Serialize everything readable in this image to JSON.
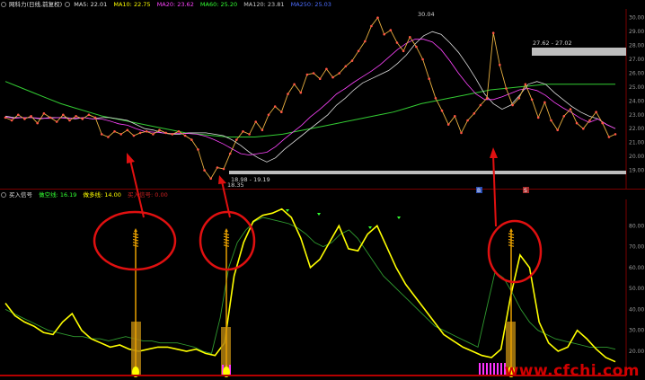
{
  "header": {
    "stock_name": "网科力(日线,前复权)",
    "ma5": "MA5: 22.01",
    "ma10": "MA10: 22.75",
    "ma20": "MA20: 23.62",
    "ma60": "MA60: 25.20",
    "ma120": "MA120: 23.81",
    "ma250": "MA250: 25.03",
    "colors": {
      "ma5": "#e0e0e0",
      "ma10": "#ffff00",
      "ma20": "#ff44ff",
      "ma60": "#33ff33",
      "ma120": "#c8c8c8",
      "ma250": "#4d6dff"
    }
  },
  "indicator_header": {
    "name": "买入信号",
    "line1": "做空线: 16.19",
    "line2": "做多线: 14.00",
    "line3": "买入信号: 0.00"
  },
  "price_axis": {
    "ticks": [
      "30.00",
      "29.00",
      "28.00",
      "27.00",
      "26.00",
      "25.00",
      "24.00",
      "23.00",
      "22.00",
      "21.00",
      "20.00",
      "19.00"
    ]
  },
  "indicator_axis": {
    "ticks": [
      "80.00",
      "70.00",
      "60.00",
      "50.00",
      "40.00",
      "30.00",
      "20.00"
    ]
  },
  "annotations": {
    "high_label": "30.04",
    "low_label": "18.35",
    "low_range": "18.98 - 19.19",
    "gap_range": "27.62 - 27.02",
    "event_marker_1": "B",
    "event_marker_2": "S"
  },
  "watermark": "www.cfchi.com",
  "colors": {
    "candle": "#ff4444",
    "ma_line": "#e9b040",
    "signal_yellow": "#ffff00",
    "signal_green": "#33bb33",
    "circle_red": "#e01010",
    "arrow_red": "#e01010",
    "gold_bar": "#c89010",
    "magenta_bar": "#ff33ff"
  },
  "chart_data": [
    {
      "type": "line",
      "title": "网科力(日线,前复权)",
      "xlabel": "",
      "ylabel": "",
      "ylim": [
        18,
        30.5
      ],
      "series": [
        {
          "name": "price",
          "values": [
            22.8,
            22.6,
            23.0,
            22.7,
            22.9,
            22.4,
            23.1,
            22.8,
            22.5,
            23.0,
            22.6,
            22.9,
            22.7,
            23.0,
            22.8,
            21.6,
            21.4,
            21.8,
            21.6,
            21.9,
            21.5,
            21.7,
            21.8,
            21.6,
            21.9,
            21.7,
            21.6,
            21.8,
            21.5,
            21.2,
            20.5,
            19.0,
            18.4,
            19.2,
            19.1,
            20.2,
            21.2,
            21.8,
            21.6,
            22.5,
            21.9,
            23.0,
            23.6,
            23.2,
            24.5,
            25.2,
            24.6,
            25.9,
            26.0,
            25.6,
            26.3,
            25.7,
            26.0,
            26.5,
            26.9,
            27.6,
            28.3,
            29.4,
            30.0,
            28.8,
            29.1,
            28.2,
            27.6,
            28.6,
            27.9,
            27.0,
            25.6,
            24.2,
            23.3,
            22.3,
            22.9,
            21.7,
            22.6,
            23.1,
            23.7,
            24.2,
            28.9,
            26.6,
            24.9,
            23.7,
            24.2,
            25.2,
            24.1,
            22.8,
            23.9,
            22.6,
            21.9,
            22.9,
            23.4,
            22.4,
            22.0,
            22.6,
            23.2,
            22.4,
            21.4,
            21.6
          ]
        },
        {
          "name": "MA5",
          "values": [
            22.9,
            22.8,
            22.8,
            22.8,
            22.7,
            22.8,
            22.8,
            22.8,
            22.7,
            22.8,
            22.7,
            22.8,
            22.8,
            22.7,
            22.6,
            22.3,
            22.0,
            21.9,
            21.7,
            21.6,
            21.6,
            21.7,
            21.7,
            21.7,
            21.6,
            21.5,
            21.2,
            20.8,
            20.3,
            19.9,
            19.6,
            19.9,
            20.5,
            21.0,
            21.5,
            22.0,
            22.5,
            23.0,
            23.7,
            24.2,
            24.8,
            25.3,
            25.6,
            25.9,
            26.2,
            26.7,
            27.3,
            28.1,
            28.7,
            29.0,
            28.8,
            28.2,
            27.5,
            26.6,
            25.6,
            24.5,
            23.8,
            23.4,
            23.7,
            24.4,
            25.2,
            25.4,
            25.2,
            24.6,
            24.1,
            23.6,
            23.2,
            22.9,
            22.7,
            22.3,
            22.0
          ]
        },
        {
          "name": "MA60",
          "values": [
            25.4,
            25.0,
            24.6,
            24.2,
            23.8,
            23.5,
            23.2,
            22.9,
            22.7,
            22.5,
            22.3,
            22.1,
            21.9,
            21.7,
            21.6,
            21.5,
            21.4,
            21.4,
            21.4,
            21.5,
            21.6,
            21.8,
            22.0,
            22.2,
            22.4,
            22.6,
            22.8,
            23.0,
            23.2,
            23.5,
            23.8,
            24.0,
            24.2,
            24.4,
            24.6,
            24.8,
            24.9,
            25.0,
            25.1,
            25.2,
            25.2,
            25.2,
            25.2,
            25.2,
            25.2
          ]
        }
      ]
    },
    {
      "type": "line",
      "title": "买入信号",
      "xlabel": "",
      "ylabel": "",
      "ylim": [
        14,
        90
      ],
      "series": [
        {
          "name": "做空线",
          "values": [
            40,
            38,
            36,
            34,
            32,
            30,
            29,
            28,
            27,
            27,
            26,
            26,
            25,
            26,
            27,
            26,
            25,
            25,
            24,
            24,
            24,
            23,
            22,
            20,
            19,
            36,
            60,
            72,
            78,
            82,
            84,
            83,
            82,
            81,
            79,
            76,
            72,
            70,
            72,
            76,
            78,
            74,
            68,
            62,
            56,
            52,
            48,
            44,
            40,
            36,
            32,
            30,
            28,
            26,
            24,
            22,
            40,
            58,
            55,
            48,
            40,
            34,
            30,
            28,
            26,
            25,
            24,
            23,
            22,
            22,
            22,
            21
          ]
        },
        {
          "name": "做多线",
          "values": [
            43,
            37,
            34,
            32,
            29,
            28,
            34,
            38,
            30,
            26,
            24,
            22,
            23,
            21,
            20,
            21,
            22,
            22,
            21,
            20,
            21,
            19,
            18,
            24,
            56,
            72,
            82,
            85,
            86,
            88,
            84,
            74,
            60,
            64,
            72,
            80,
            69,
            68,
            76,
            80,
            70,
            60,
            52,
            46,
            40,
            34,
            28,
            25,
            22,
            20,
            18,
            17,
            21,
            46,
            66,
            60,
            34,
            24,
            20,
            22,
            30,
            26,
            21,
            17,
            15
          ]
        },
        {
          "name": "买入信号",
          "values": [
            0,
            0,
            0,
            1,
            0,
            0,
            0,
            0,
            0,
            0,
            0,
            1,
            0,
            0,
            0,
            0,
            0,
            0,
            0,
            0,
            0,
            0,
            0,
            0,
            0,
            0,
            0,
            0,
            1,
            0,
            0
          ]
        }
      ]
    }
  ]
}
